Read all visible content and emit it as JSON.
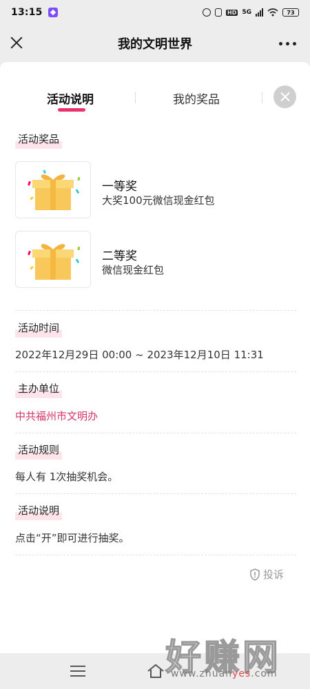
{
  "status_bar": {
    "time": "13:15",
    "network": "5G",
    "hd": "HD",
    "battery": "73"
  },
  "header": {
    "title": "我的文明世界"
  },
  "tabs": [
    {
      "label": "活动说明",
      "active": true
    },
    {
      "label": "我的奖品",
      "active": false
    }
  ],
  "sections": {
    "prizes_label": "活动奖品",
    "prizes": [
      {
        "name": "一等奖",
        "desc": "大奖100元微信现金红包"
      },
      {
        "name": "二等奖",
        "desc": "微信现金红包"
      }
    ],
    "time_label": "活动时间",
    "time_value": "2022年12月29日 00:00 ~ 2023年12月10日 11:31",
    "organizer_label": "主办单位",
    "organizer_value": "中共福州市文明办",
    "rules_label": "活动规则",
    "rules_value": "每人有 1次抽奖机会。",
    "desc_label": "活动说明",
    "desc_value": "点击“开”即可进行抽奖。"
  },
  "report_label": "投诉",
  "watermark": {
    "big": "好赚网",
    "url_prefix": "www.zhuan",
    "url_accent": "yes",
    "url_suffix": ".com"
  },
  "colors": {
    "accent": "#e8336d",
    "organizer": "#d5336b",
    "label_highlight": "#fde3ea"
  }
}
